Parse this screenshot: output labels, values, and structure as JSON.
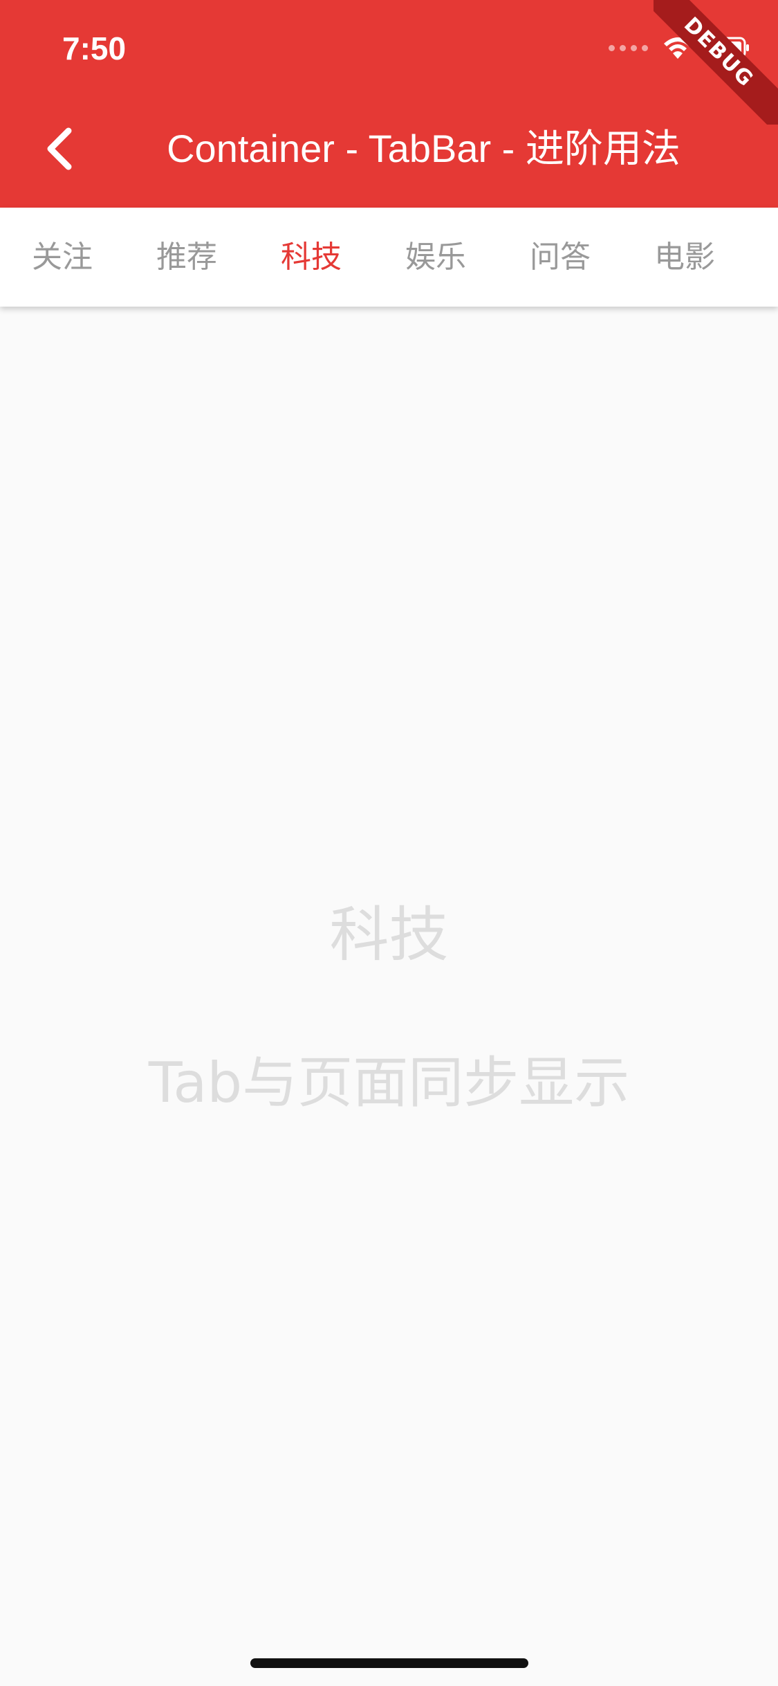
{
  "status_bar": {
    "time": "7:50",
    "icons": [
      "signal-dots-icon",
      "wifi-icon",
      "battery-icon"
    ]
  },
  "app_bar": {
    "title": "Container - TabBar - 进阶用法",
    "back_icon": "chevron-left-icon",
    "background_color": "#E53935"
  },
  "debug_banner": {
    "label": "DEBUG"
  },
  "tabs": [
    {
      "label": "关注",
      "active": false
    },
    {
      "label": "推荐",
      "active": false
    },
    {
      "label": "科技",
      "active": true
    },
    {
      "label": "娱乐",
      "active": false
    },
    {
      "label": "问答",
      "active": false
    },
    {
      "label": "电影",
      "active": false
    }
  ],
  "content": {
    "title": "科技",
    "subtitle": "Tab与页面同步显示"
  },
  "colors": {
    "accent": "#E53935",
    "tab_inactive": "#999999",
    "content_text": "#DDDDDD",
    "page_background": "#FAFAFA"
  }
}
